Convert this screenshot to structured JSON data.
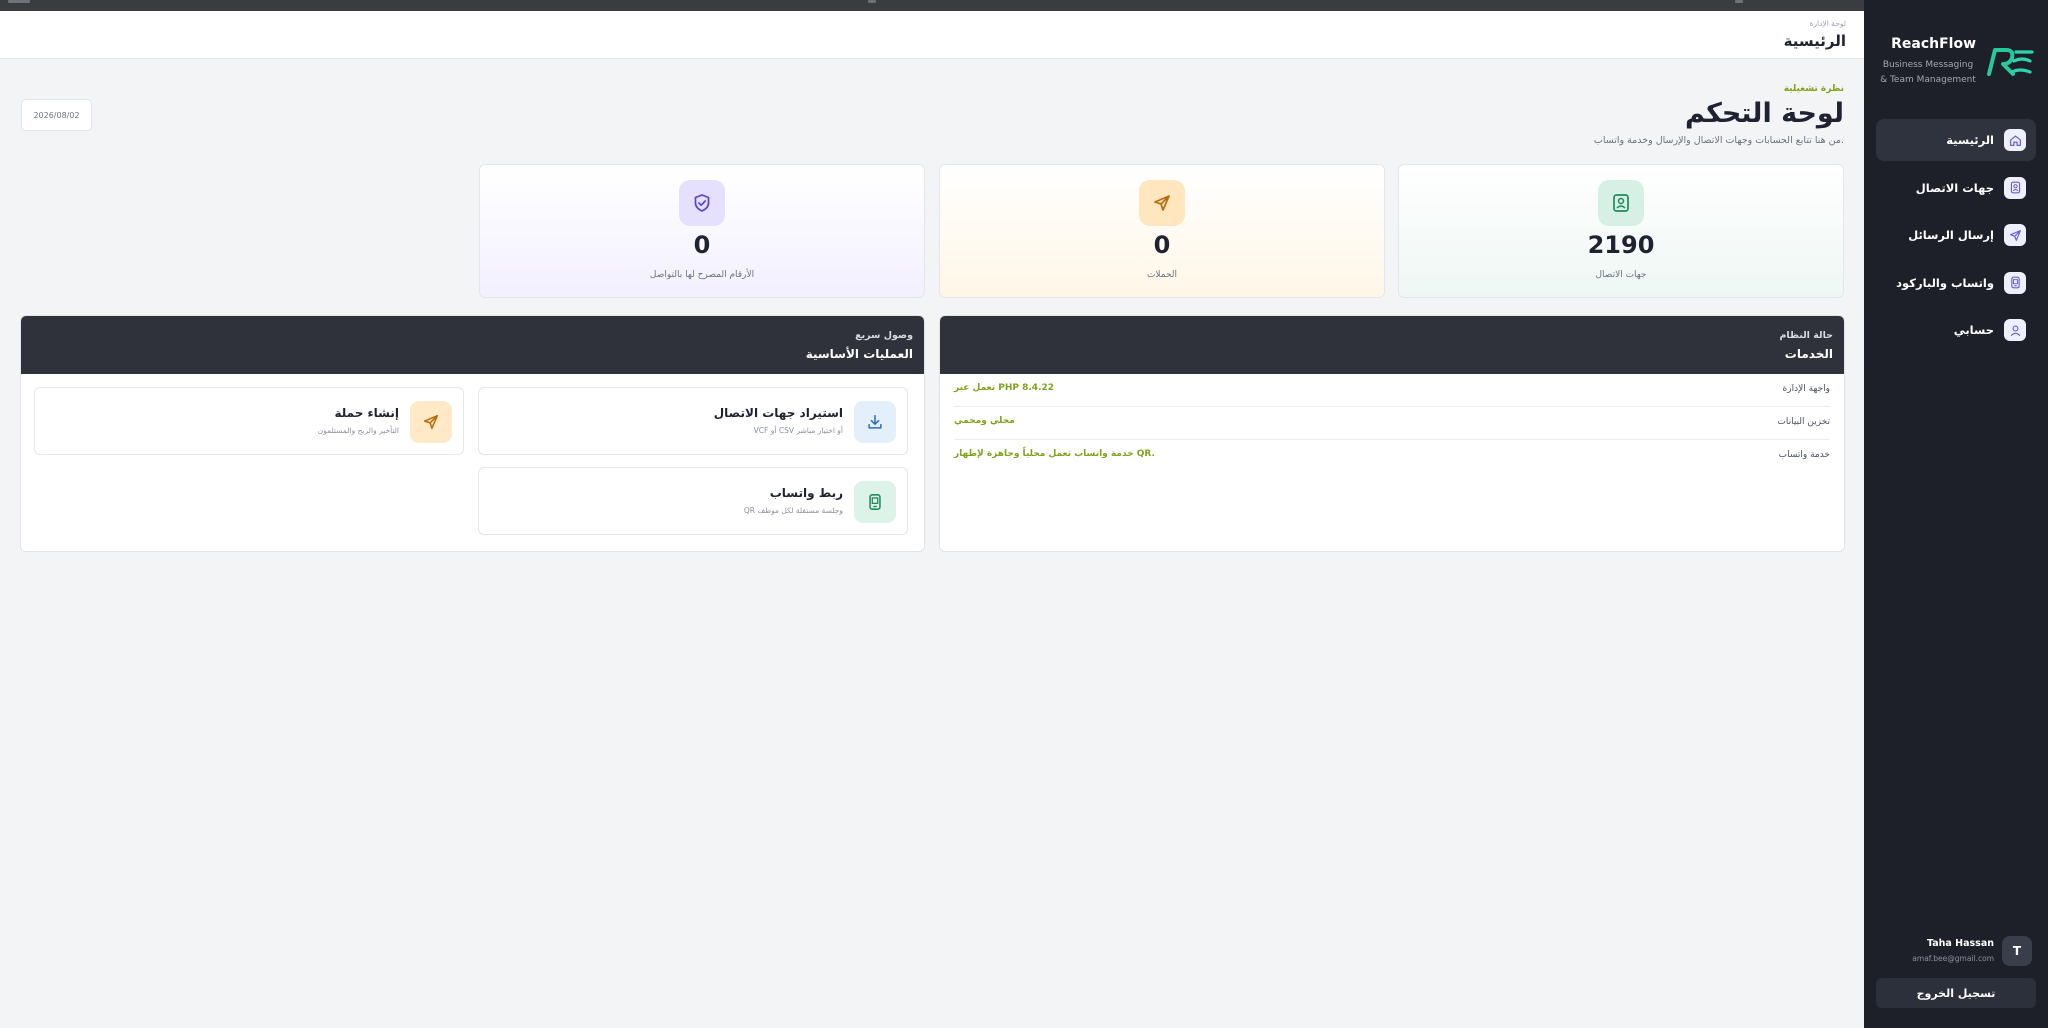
{
  "brand": {
    "name": "ReachFlow",
    "tagline": "Business Messaging & Team Management",
    "accent": "#22c3a6"
  },
  "sidebar": {
    "items": [
      {
        "label": "الرئيسية",
        "icon": "home-icon",
        "active": true
      },
      {
        "label": "جهات الاتصال",
        "icon": "contacts-icon",
        "active": false
      },
      {
        "label": "إرسال الرسائل",
        "icon": "send-icon",
        "active": false
      },
      {
        "label": "واتساب والباركود",
        "icon": "whatsapp-qr-icon",
        "active": false
      },
      {
        "label": "حسابي",
        "icon": "user-icon",
        "active": false
      }
    ],
    "user": {
      "initial": "T",
      "name": "Taha Hassan",
      "email": "amaf.bee@gmail.com"
    },
    "logout_label": "تسجيل الخروج"
  },
  "header": {
    "breadcrumb": "لوحة الإدارة",
    "title": "الرئيسية"
  },
  "overview": {
    "kicker": "نظرة تشغيلية",
    "title": "لوحة التحكم",
    "subtitle": "من هنا تتابع الحسابات وجهات الاتصال والإرسال وخدمة واتساب.",
    "date": "2026/08/02"
  },
  "stats": [
    {
      "label": "جهات الاتصال",
      "value": "2190",
      "icon": "contact-card-icon"
    },
    {
      "label": "الحملات",
      "value": "0",
      "icon": "send-icon"
    },
    {
      "label": "الأرقام المصرح لها بالتواصل",
      "value": "0",
      "icon": "shield-check-icon"
    }
  ],
  "services": {
    "kicker": "حالة النظام",
    "title": "الخدمات",
    "rows": [
      {
        "name": "واجهة الإدارة",
        "status": "تعمل عبر PHP 8.4.22"
      },
      {
        "name": "تخزين البيانات",
        "status": "محلي ومحمي"
      },
      {
        "name": "خدمة واتساب",
        "status": "خدمة واتساب تعمل محلياً وجاهزة لإظهار QR."
      }
    ]
  },
  "operations": {
    "kicker": "وصول سريع",
    "title": "العمليات الأساسية",
    "cards": [
      {
        "title": "استيراد جهات الاتصال",
        "desc": "VCF أو CSV أو اختيار مباشر",
        "icon": "download-icon"
      },
      {
        "title": "إنشاء حملة",
        "desc": "التأخير والربح والمستلمون",
        "icon": "send-icon"
      },
      {
        "title": "ربط واتساب",
        "desc": "QR وجلسة مستقلة لكل موظف",
        "icon": "whatsapp-qr-icon"
      }
    ]
  },
  "colors": {
    "sidebar_bg": "#1d2029",
    "panel_head_bg": "#30323b",
    "status_green": "#7ea21b",
    "page_bg": "#f3f4f6"
  }
}
